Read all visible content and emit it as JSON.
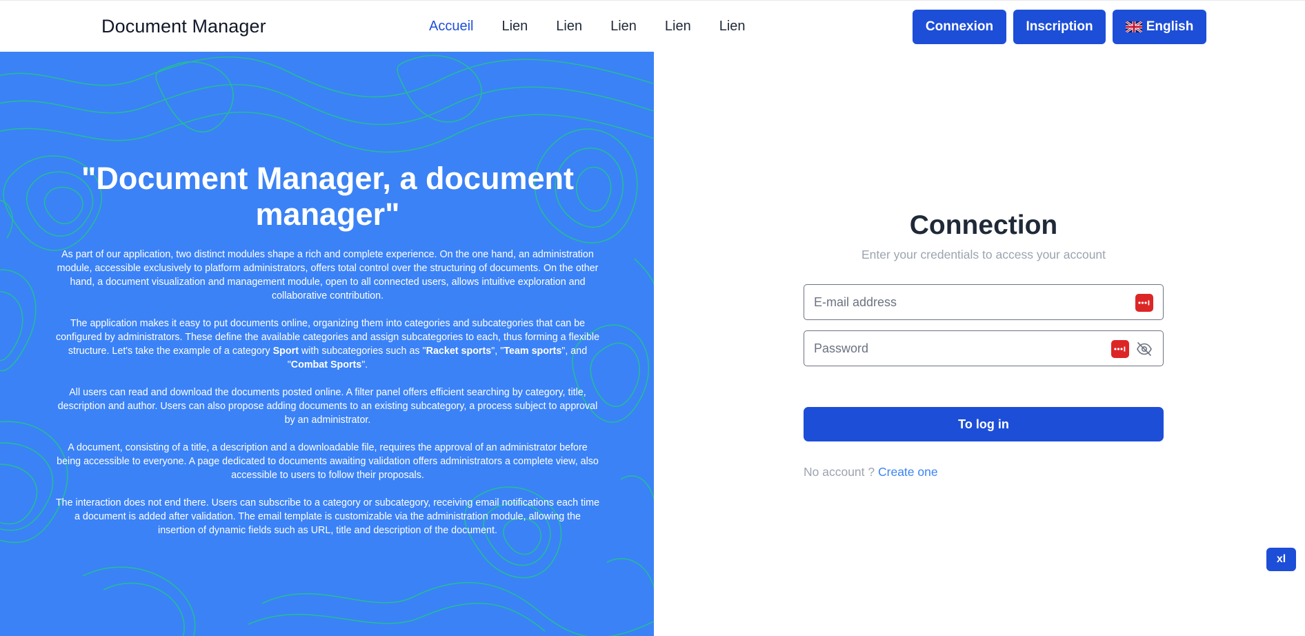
{
  "navbar": {
    "brand": "Document Manager",
    "links": [
      "Accueil",
      "Lien",
      "Lien",
      "Lien",
      "Lien",
      "Lien"
    ],
    "active_link": "Accueil",
    "login_button": "Connexion",
    "signup_button": "Inscription",
    "language_button": "English",
    "language_flag_icon": "uk-flag-icon"
  },
  "hero": {
    "title": "\"Document Manager, a document manager\"",
    "p1": "As part of our application, two distinct modules shape a rich and complete experience. On the one hand, an administration module, accessible exclusively to platform administrators, offers total control over the structuring of documents. On the other hand, a document visualization and management module, open to all connected users, allows intuitive exploration and collaborative contribution.",
    "p2_before": "The application makes it easy to put documents online, organizing them into categories and subcategories that can be configured by administrators. These define the available categories and assign subcategories to each, thus forming a flexible structure. Let's take the example of a category ",
    "p2_sport": "Sport",
    "p2_mid1": " with subcategories such as \"",
    "p2_racket": "Racket sports",
    "p2_mid2": "\", \"",
    "p2_team": "Team sports",
    "p2_mid3": "\", and \"",
    "p2_combat": "Combat Sports",
    "p2_end": "\".",
    "p3": "All users can read and download the documents posted online. A filter panel offers efficient searching by category, title, description and author. Users can also propose adding documents to an existing subcategory, a process subject to approval by an administrator.",
    "p4": "A document, consisting of a title, a description and a downloadable file, requires the approval of an administrator before being accessible to everyone. A page dedicated to documents awaiting validation offers administrators a complete view, also accessible to users to follow their proposals.",
    "p5": "The interaction does not end there. Users can subscribe to a category or subcategory, receiving email notifications each time a document is added after validation. The email template is customizable via the administration module, allowing the insertion of dynamic fields such as URL, title and description of the document.",
    "background_color": "#3b82f6",
    "contour_color": "#22c58b"
  },
  "login": {
    "title": "Connection",
    "subtitle": "Enter your credentials to access your account",
    "email_placeholder": "E-mail address",
    "email_value": "",
    "password_placeholder": "Password",
    "password_value": "",
    "password_manager_icon": "password-manager-icon",
    "toggle_visibility_icon": "eye-slash-icon",
    "submit_label": "To log in",
    "no_account_text": "No account ?",
    "create_link": "Create one"
  },
  "breakpoint_badge": "xl",
  "colors": {
    "primary": "#1d4ed8",
    "link": "#3b82f6",
    "muted": "#9ca3af"
  }
}
